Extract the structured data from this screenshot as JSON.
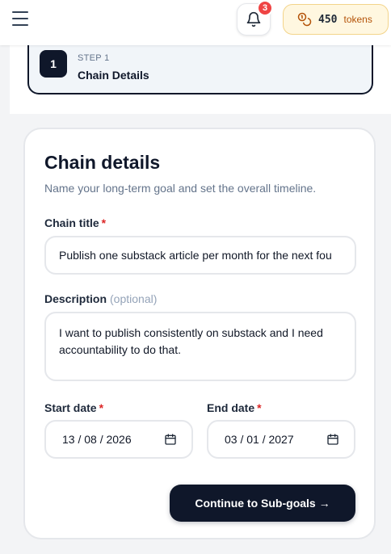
{
  "header": {
    "notifications_count": "3",
    "tokens_amount": "450",
    "tokens_label": "tokens"
  },
  "step": {
    "number": "1",
    "kicker": "STEP 1",
    "title": "Chain Details"
  },
  "form": {
    "title": "Chain details",
    "subtitle": "Name your long-term goal and set the overall timeline.",
    "chain_title_label": "Chain title",
    "chain_title_value": "Publish one substack article per month for the next fou",
    "description_label": "Description",
    "description_optional": "(optional)",
    "description_value": "I want to publish consistently on substack and I need accountability to do that.",
    "start_date_label": "Start date",
    "start_date_value": "13 / 08 / 2026",
    "end_date_label": "End date",
    "end_date_value": "03 / 01 / 2027",
    "required_marker": "*",
    "continue_label": "Continue to Sub-goals →"
  },
  "colors": {
    "primary": "#0f172a",
    "badge": "#ef4444",
    "required": "#dc2626",
    "token_pill_bg": "#fff7e0",
    "token_coin": "#b45309"
  },
  "icons": [
    "menu-icon",
    "bell-icon",
    "coins-icon",
    "calendar-icon"
  ]
}
